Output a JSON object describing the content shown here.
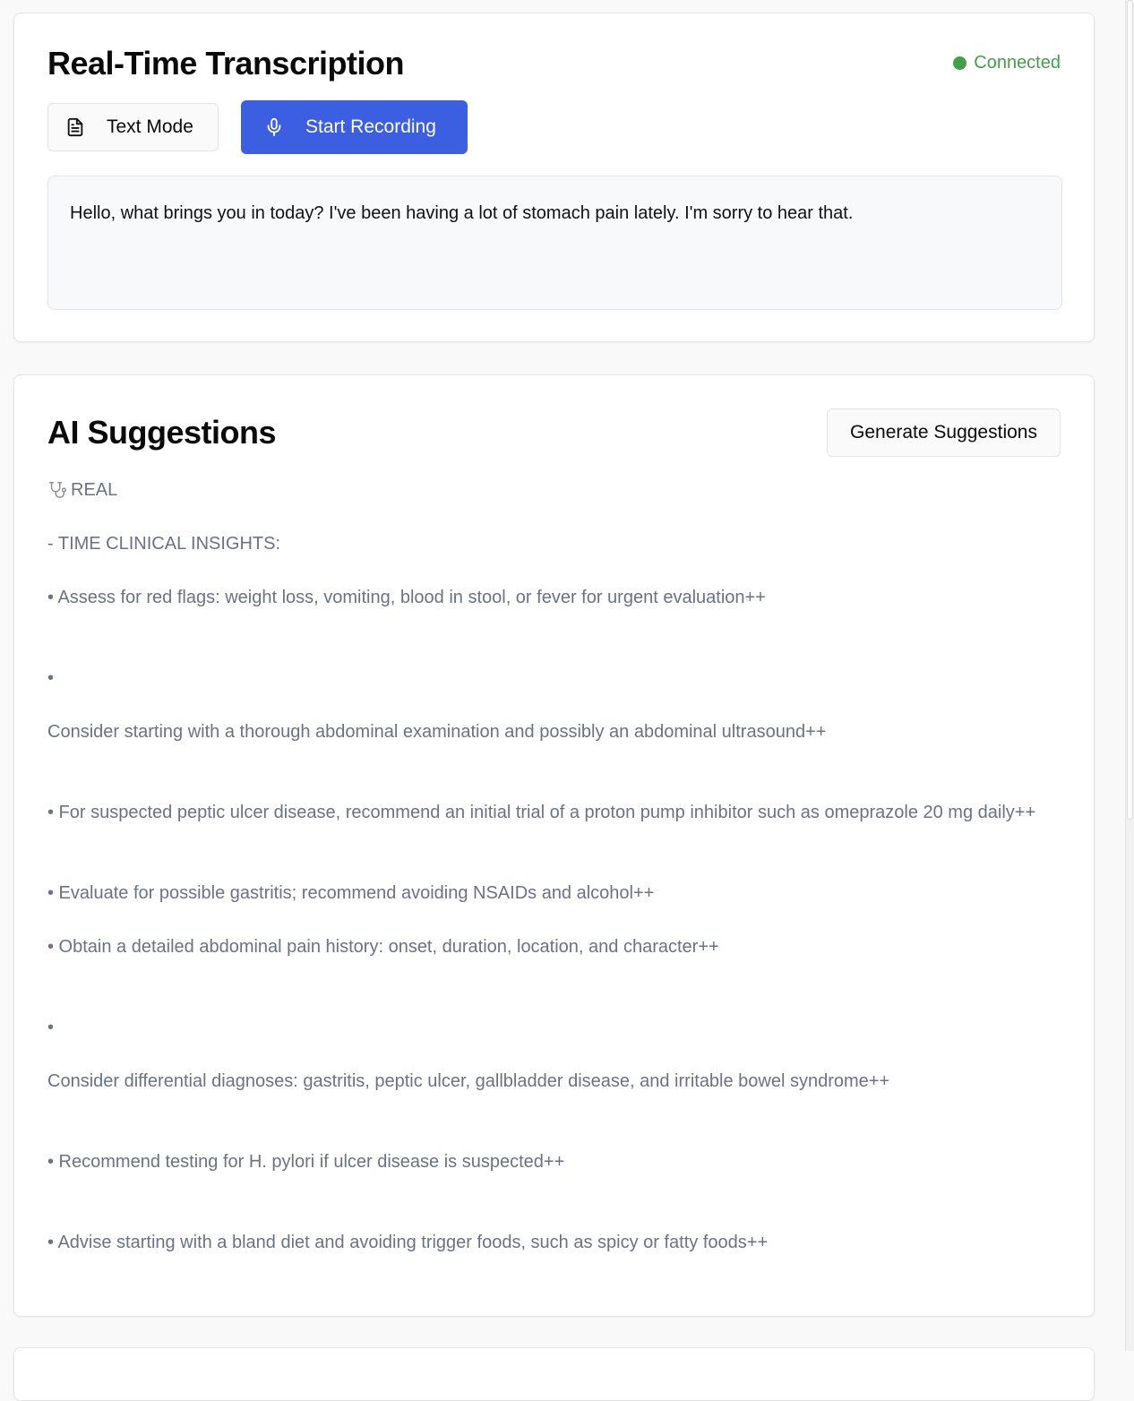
{
  "transcription": {
    "title": "Real-Time Transcription",
    "status_text": "Connected",
    "status_color": "#43a047",
    "text_mode_label": "Text Mode",
    "text_mode_icon": "document-icon",
    "record_label": "Start Recording",
    "record_icon": "microphone-icon",
    "record_color": "#3b5fe0",
    "transcript_text": "Hello, what brings you in today? I've been having a lot of stomach pain lately. I'm sorry to hear that."
  },
  "suggestions": {
    "title": "AI Suggestions",
    "generate_label": "Generate Suggestions",
    "header_icon": "stethoscope-icon",
    "lines": [
      "REAL",
      "- TIME CLINICAL INSIGHTS:",
      "• Assess for red flags: weight loss, vomiting, blood in stool, or fever for urgent evaluation++",
      "•",
      "Consider starting with a thorough abdominal examination and possibly an abdominal ultrasound++",
      "• For suspected peptic ulcer disease, recommend an initial trial of a proton pump inhibitor such as omeprazole 20 mg daily++",
      "• Evaluate for possible gastritis; recommend avoiding NSAIDs and alcohol++",
      "• Obtain a detailed abdominal pain history: onset, duration, location, and character++",
      "•",
      "Consider differential diagnoses: gastritis, peptic ulcer, gallbladder disease, and irritable bowel syndrome++",
      "• Recommend testing for H. pylori if ulcer disease is suspected++",
      "• Advise starting with a bland diet and avoiding trigger foods, such as spicy or fatty foods++"
    ]
  }
}
